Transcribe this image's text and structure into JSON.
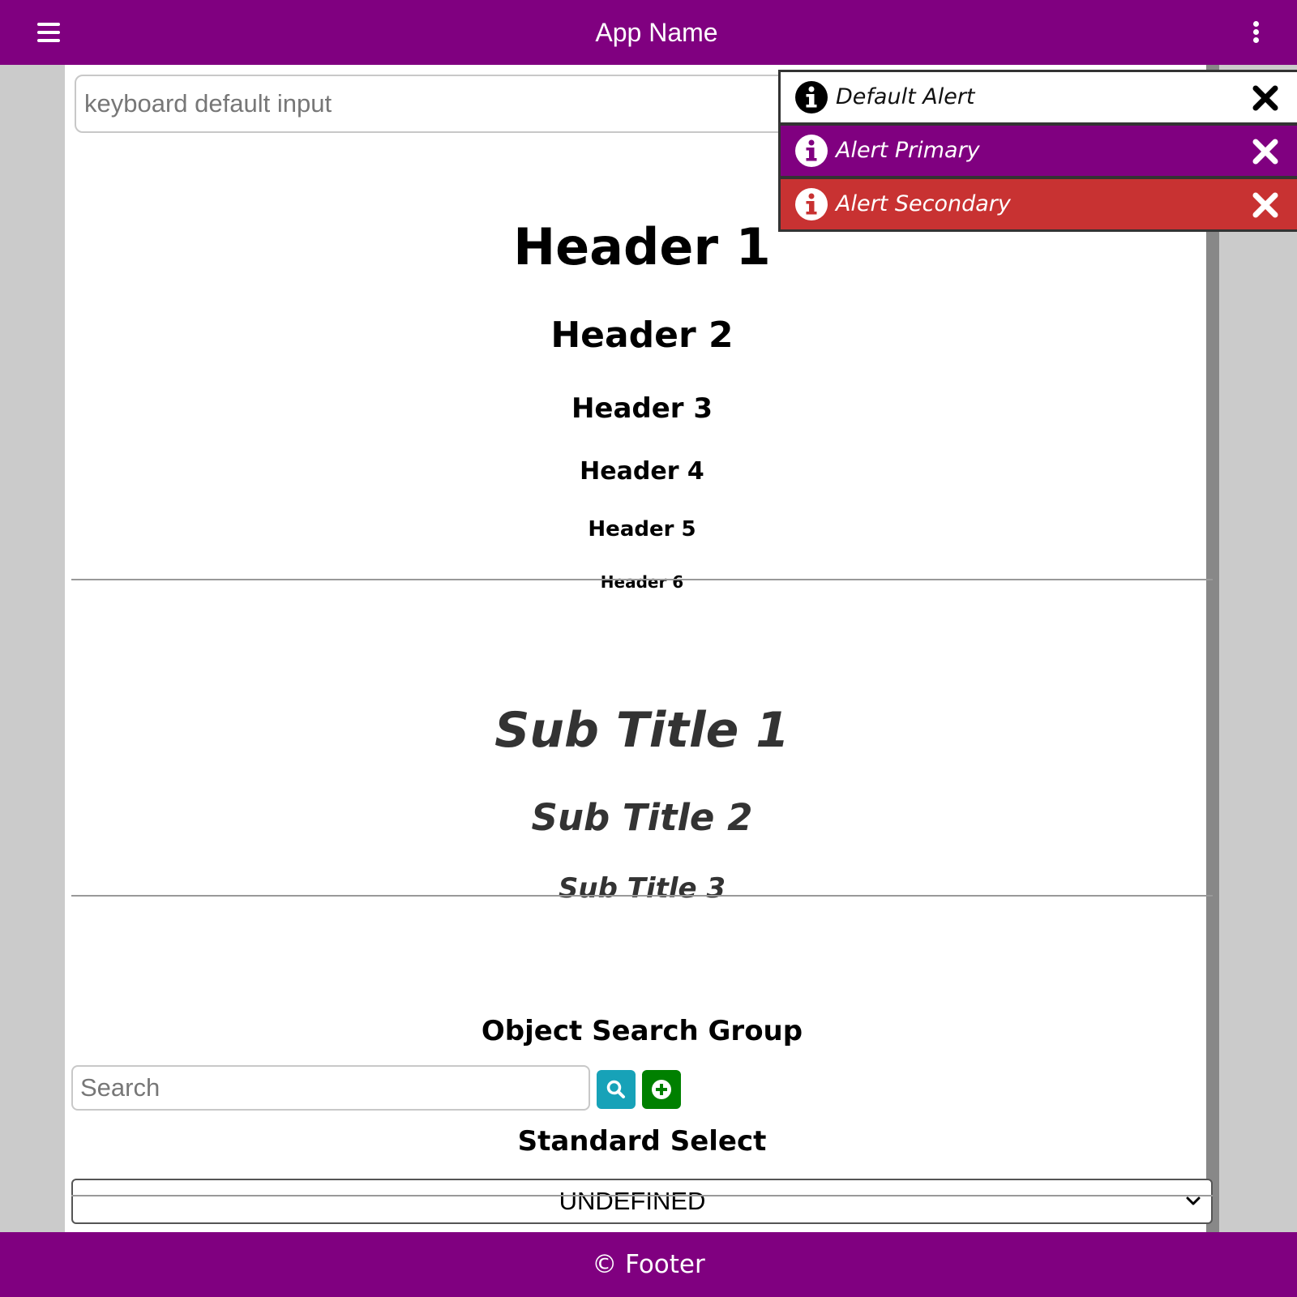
{
  "app": {
    "title": "App Name",
    "menu_icon": "hamburger-icon",
    "more_icon": "kebab-icon",
    "brand_color": "#800080"
  },
  "keyboard_input": {
    "placeholder": "keyboard default input",
    "value": ""
  },
  "headers": {
    "h1": "Header 1",
    "h2": "Header 2",
    "h3": "Header 3",
    "h4": "Header 4",
    "h5": "Header 5",
    "h6": "Header 6"
  },
  "subtitles": {
    "s1": "Sub Title 1",
    "s2": "Sub Title 2",
    "s3": "Sub Title 3"
  },
  "search_group": {
    "title": "Object Search Group",
    "placeholder": "Search",
    "value": "",
    "search_button_icon": "search-icon",
    "add_button_icon": "plus-circle-icon",
    "search_button_color": "#17a2b8",
    "add_button_color": "#008000"
  },
  "select": {
    "title": "Standard Select",
    "selected": "UNDEFINED"
  },
  "footer": {
    "text": "© Footer"
  },
  "alerts": [
    {
      "text": "Default Alert",
      "variant": "default",
      "icon": "info-icon",
      "close_icon": "close-icon",
      "color": "#ffffff"
    },
    {
      "text": "Alert Primary",
      "variant": "primary",
      "icon": "info-icon",
      "close_icon": "close-icon",
      "color": "#800080"
    },
    {
      "text": "Alert Secondary",
      "variant": "secondary",
      "icon": "info-icon",
      "close_icon": "close-icon",
      "color": "#c83232"
    }
  ]
}
